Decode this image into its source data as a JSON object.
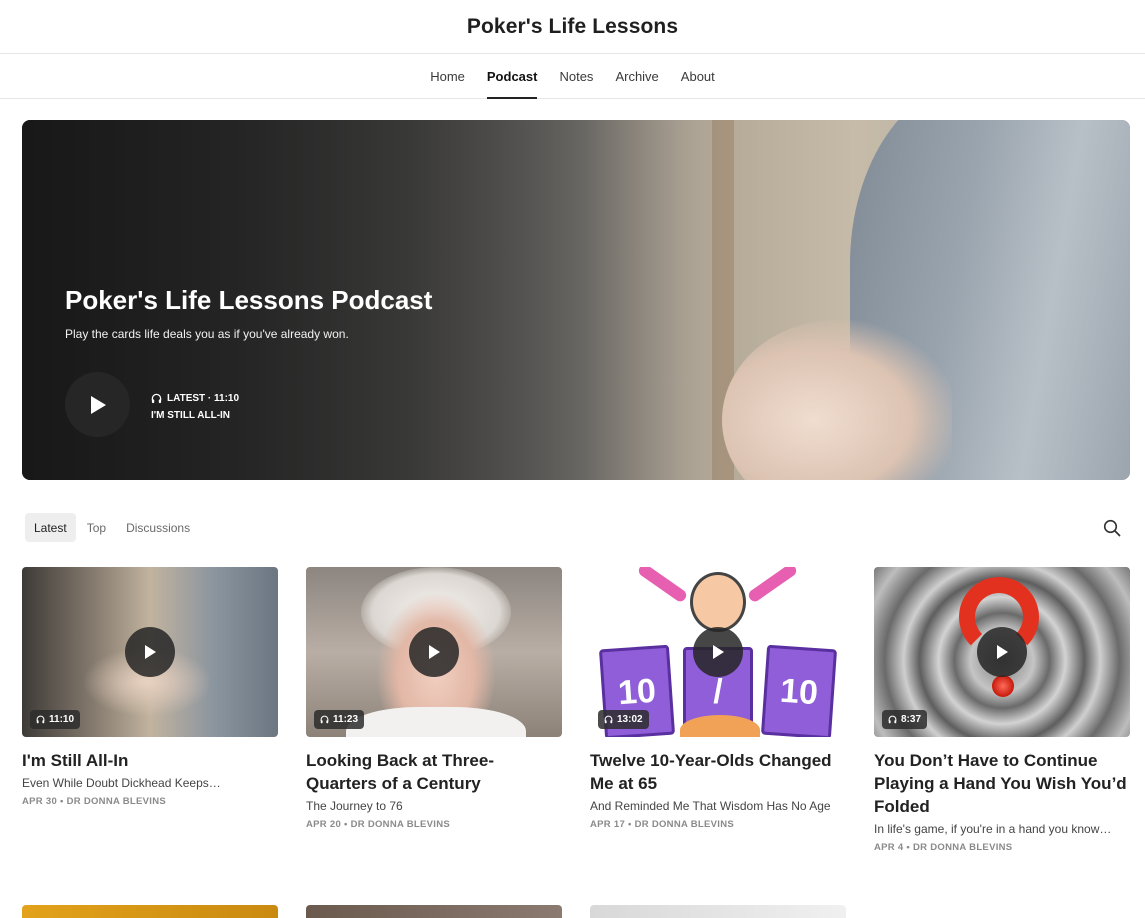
{
  "site": {
    "title": "Poker's Life Lessons"
  },
  "nav": {
    "items": [
      {
        "label": "Home",
        "active": false
      },
      {
        "label": "Podcast",
        "active": true
      },
      {
        "label": "Notes",
        "active": false
      },
      {
        "label": "Archive",
        "active": false
      },
      {
        "label": "About",
        "active": false
      }
    ]
  },
  "hero": {
    "title": "Poker's Life Lessons Podcast",
    "subtitle": "Play the cards life deals you as if you've already won.",
    "latest_label": "LATEST · 11:10",
    "episode_title": "I'M STILL ALL-IN",
    "play_icon": "play-icon",
    "headphones_icon": "headphones-icon"
  },
  "tabs": {
    "items": [
      {
        "label": "Latest",
        "active": true
      },
      {
        "label": "Top",
        "active": false
      },
      {
        "label": "Discussions",
        "active": false
      }
    ],
    "search_icon": "search-icon"
  },
  "posts": [
    {
      "duration": "11:10",
      "title": "I'm Still All-In",
      "subtitle": "Even While Doubt Dickhead Keeps…",
      "meta": "APR 30 • DR DONNA BLEVINS"
    },
    {
      "duration": "11:23",
      "title": "Looking Back at Three-Quarters of a Century",
      "subtitle": "The Journey to 76",
      "meta": "APR 20 • DR DONNA BLEVINS"
    },
    {
      "duration": "13:02",
      "title": "Twelve 10-Year-Olds Changed Me at 65",
      "subtitle": "And Reminded Me That Wisdom Has No Age",
      "meta": "APR 17 • DR DONNA BLEVINS"
    },
    {
      "duration": "8:37",
      "title": "You Don’t Have to Continue Playing a Hand You Wish You’d Folded",
      "subtitle": "In life's game, if you're in a hand you know…",
      "meta": "APR 4 • DR DONNA BLEVINS"
    }
  ],
  "thumb_art": {
    "card_left": "10",
    "card_mid": "/",
    "card_right": "10"
  },
  "colors": {
    "accent": "#222222",
    "hero_dark": "#262626",
    "meta_gray": "#8a8a8a"
  }
}
